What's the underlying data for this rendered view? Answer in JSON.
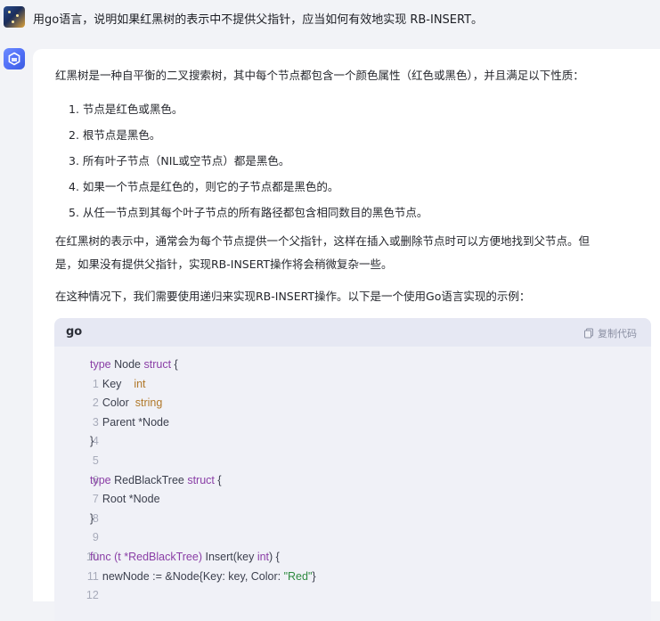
{
  "user": {
    "message": "用go语言，说明如果红黑树的表示中不提供父指针，应当如何有效地实现 RB-INSERT。"
  },
  "answer": {
    "intro": "红黑树是一种自平衡的二叉搜索树，其中每个节点都包含一个颜色属性（红色或黑色），并且满足以下性质：",
    "properties": [
      "1. 节点是红色或黑色。",
      "2. 根节点是黑色。",
      "3. 所有叶子节点（NIL或空节点）都是黑色。",
      "4. 如果一个节点是红色的，则它的子节点都是黑色的。",
      "5. 从任一节点到其每个叶子节点的所有路径都包含相同数目的黑色节点。"
    ],
    "para2_line1": "在红黑树的表示中，通常会为每个节点提供一个父指针，这样在插入或删除节点时可以方便地找到父节点。但",
    "para2_line2": "是，如果没有提供父指针，实现RB-INSERT操作将会稍微复杂一些。",
    "para3": "在这种情况下，我们需要使用递归来实现RB-INSERT操作。以下是一个使用Go语言实现的示例：",
    "code": {
      "language": "go",
      "copy_label": "复制代码",
      "line_numbers": [
        "1",
        "2",
        "3",
        "4",
        "5",
        "6",
        "7",
        "8",
        "9",
        "10",
        "11",
        "12"
      ],
      "l1": {
        "kw": "type",
        "name": " Node ",
        "kw2": "struct",
        "rest": " {"
      },
      "l2": {
        "name": "    Key    ",
        "type": "int"
      },
      "l3": {
        "name": "    Color  ",
        "type": "string"
      },
      "l4": {
        "text": "    Parent *Node"
      },
      "l5": {
        "text": "}"
      },
      "l7": {
        "kw": "type",
        "name": " RedBlackTree ",
        "kw2": "struct",
        "rest": " {"
      },
      "l8": {
        "text": "    Root *Node"
      },
      "l9": {
        "text": "}"
      },
      "l11": {
        "kw": "func",
        "recv": " (t *RedBlackTree) ",
        "name": "Insert(key ",
        "type": "int",
        "rest": ") {"
      },
      "l12": {
        "pre": "    newNode := &Node{Key: key, Color: ",
        "str": "\"Red\"",
        "rest": "}"
      }
    }
  },
  "colors": {
    "background": "#f2f3f7",
    "card": "#ffffff",
    "code_bg": "#f0f1f7",
    "keyword": "#8a3ea6",
    "type": "#b0782a",
    "string": "#2e8a40"
  },
  "icons": [
    "user-avatar",
    "assistant-logo-icon",
    "copy-icon"
  ]
}
